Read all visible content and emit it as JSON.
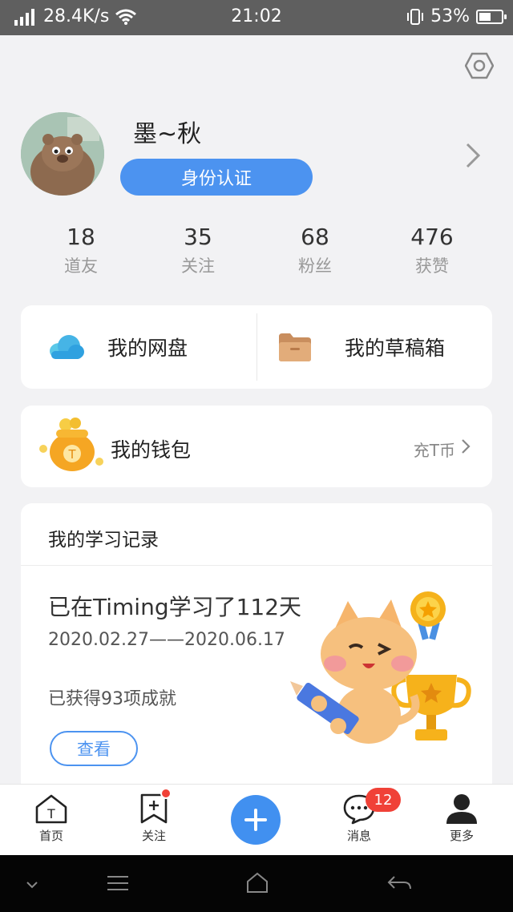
{
  "status_bar": {
    "speed": "28.4K/s",
    "time": "21:02",
    "battery": "53%",
    "battery_level": 0.53
  },
  "profile": {
    "name": "墨~秋",
    "verify_label": "身份认证"
  },
  "stats": [
    {
      "value": "18",
      "label": "道友"
    },
    {
      "value": "35",
      "label": "关注"
    },
    {
      "value": "68",
      "label": "粉丝"
    },
    {
      "value": "476",
      "label": "获赞"
    }
  ],
  "storage": {
    "cloud_disk": "我的网盘",
    "drafts": "我的草稿箱"
  },
  "wallet": {
    "title": "我的钱包",
    "recharge": "充T币",
    "coin_letter": "T"
  },
  "learning": {
    "header": "我的学习记录",
    "days": "已在Timing学习了112天",
    "range": "2020.02.27——2020.06.17",
    "achievements": "已获得93项成就",
    "view_button": "查看"
  },
  "tabbar": {
    "home": "首页",
    "home_icon_letter": "T",
    "follow": "关注",
    "messages": "消息",
    "messages_badge": "12",
    "more": "更多"
  },
  "colors": {
    "accent": "#4c93f0",
    "badge": "#f04137"
  },
  "icons": [
    "signal-icon",
    "wifi-icon",
    "vibrate-icon",
    "battery-icon",
    "settings-hexagon-icon",
    "chevron-right-icon",
    "cloud-icon",
    "folder-icon",
    "coin-bag-icon",
    "home-icon",
    "bookmark-plus-icon",
    "plus-icon",
    "chat-bubble-icon",
    "person-icon",
    "dropdown-icon",
    "menu-icon",
    "home-nav-icon",
    "back-icon"
  ]
}
